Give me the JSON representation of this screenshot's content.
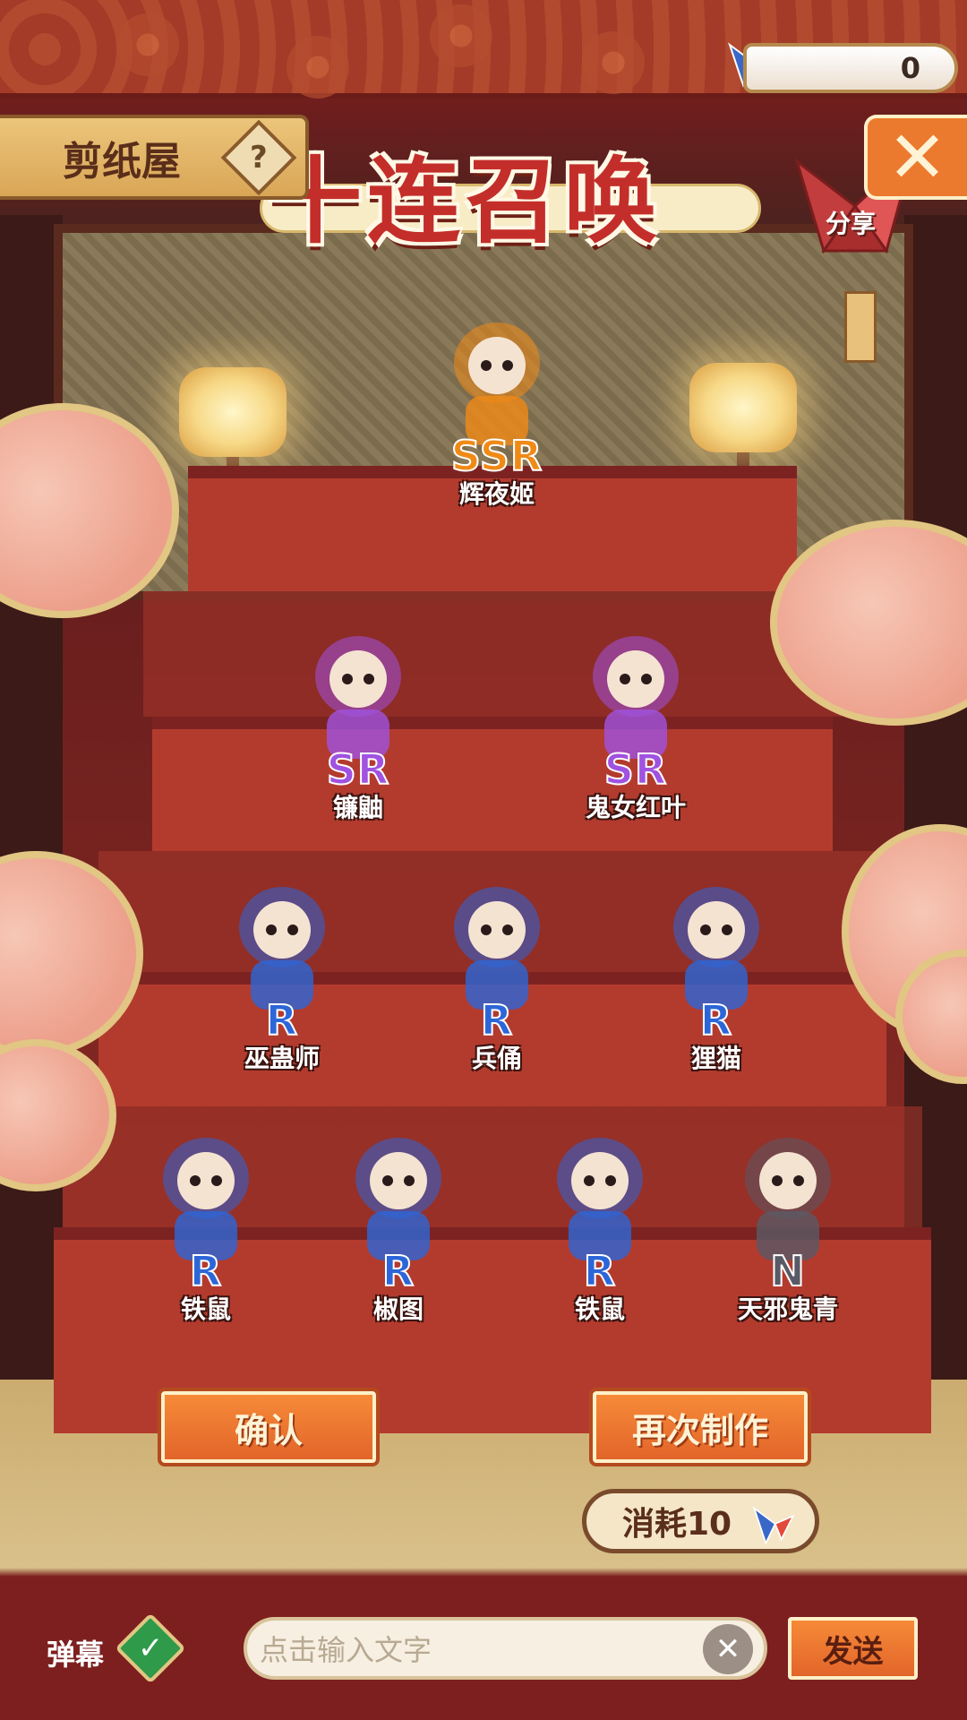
{
  "header": {
    "tab_title": "剪纸屋",
    "help_label": "?",
    "main_title": "十连召唤",
    "currency_count": "0",
    "close_label": "✕",
    "share_label": "分享"
  },
  "results": [
    {
      "rarity": "SSR",
      "name": "辉夜姬",
      "color": "#f08a16"
    },
    {
      "rarity": "SR",
      "name": "镰鼬",
      "color": "#a052e0"
    },
    {
      "rarity": "SR",
      "name": "鬼女红叶",
      "color": "#a052e0"
    },
    {
      "rarity": "R",
      "name": "巫蛊师",
      "color": "#2c66d8"
    },
    {
      "rarity": "R",
      "name": "兵俑",
      "color": "#2c66d8"
    },
    {
      "rarity": "R",
      "name": "狸猫",
      "color": "#2c66d8"
    },
    {
      "rarity": "R",
      "name": "铁鼠",
      "color": "#2c66d8"
    },
    {
      "rarity": "R",
      "name": "椒图",
      "color": "#2c66d8"
    },
    {
      "rarity": "R",
      "name": "铁鼠",
      "color": "#2c66d8"
    },
    {
      "rarity": "N",
      "name": "天邪鬼青",
      "color": "#5a5a66"
    }
  ],
  "actions": {
    "confirm_label": "确认",
    "again_label": "再次制作",
    "cost_label": "消耗10"
  },
  "chat": {
    "danmu_label": "弹幕",
    "danmu_enabled": true,
    "input_placeholder": "点击输入文字",
    "send_label": "发送"
  },
  "icons": [
    "paper-crane-icon",
    "help-icon",
    "close-icon",
    "check-icon",
    "clear-icon"
  ]
}
